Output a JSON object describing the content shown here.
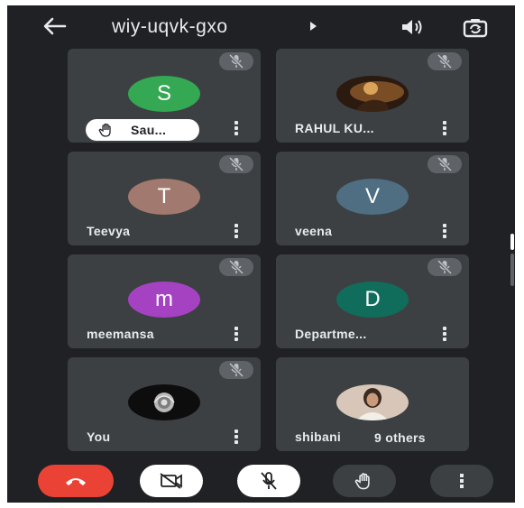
{
  "header": {
    "title": "wiy-uqvk-gxo"
  },
  "colors": {
    "background": "#202124",
    "tile": "#3c4043",
    "end_call": "#ea4335"
  },
  "participants": [
    {
      "name": "Sau...",
      "initial": "S",
      "avatar_color": "#34a853",
      "hand_raised": true
    },
    {
      "name": "RAHUL KU...",
      "initial": "",
      "avatar_color": "#6b4a2a",
      "hand_raised": false
    },
    {
      "name": "Teevya",
      "initial": "T",
      "avatar_color": "#a1796e",
      "hand_raised": false
    },
    {
      "name": "veena",
      "initial": "V",
      "avatar_color": "#4f6e82",
      "hand_raised": false
    },
    {
      "name": "meemansa",
      "initial": "m",
      "avatar_color": "#a542c2",
      "hand_raised": false
    },
    {
      "name": "Departme...",
      "initial": "D",
      "avatar_color": "#116d5b",
      "hand_raised": false
    },
    {
      "name": "You",
      "initial": "",
      "avatar_color": "#111111",
      "hand_raised": false
    },
    {
      "name": "shibani",
      "initial": "",
      "avatar_color": "#c9b5a6",
      "hand_raised": false
    }
  ],
  "others_label": "9 others",
  "controls": [
    "end-call",
    "camera-off",
    "mic-off",
    "raise-hand",
    "more-options"
  ]
}
